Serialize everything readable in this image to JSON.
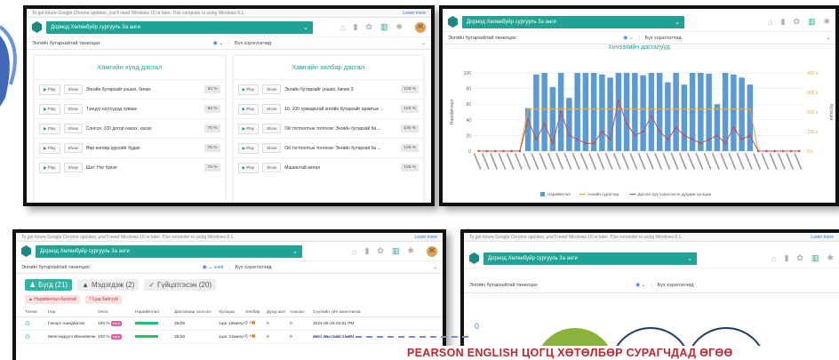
{
  "notice": {
    "text": "To get future Google Chrome updates, you'll need Windows 10 or later. This computer is using Windows 8.1.",
    "link": "Learn more"
  },
  "app": {
    "lesson_select": "Дорнод Хөлөнбуйр сургууль 3а анги",
    "avatar_letter": "Ж",
    "filter_left": "Энгийн бутархайтай танилцах",
    "filter_right": "Бүх хэрэглэгчид"
  },
  "panel1": {
    "left_title": "Хамгийн хүнд дасгал",
    "right_title": "Хамгийн хялбар дасгал",
    "play_label": "Play",
    "show_label": "Show",
    "hard": [
      {
        "title": "Энгийн бутархайг унших, бичих",
        "pct": "54 %"
      },
      {
        "title": "Тэнцүү хэсгүүдэд хуваах",
        "pct": "68 %"
      },
      {
        "title": "Сонсох: 100 дотор нэмэх, хасах",
        "pct": "70 %"
      },
      {
        "title": "Өөр өнгөөр дүрсийг будах",
        "pct": "76 %"
      },
      {
        "title": "Шат: Ног букэл",
        "pct": "78 %"
      }
    ],
    "easy": [
      {
        "title": "Энгийн бутархайг унших, бичих 3",
        "pct": "100 %"
      },
      {
        "title": "10, 100 хуваарьтай энгийн бутархайг аравтын ...",
        "pct": "100 %"
      },
      {
        "title": "Ой тогтоолтын тоглоом: Энгийн бутархай ба ...",
        "pct": "100 %"
      },
      {
        "title": "Ой тогтоолтын тоглоом: Энгийн бутархай ба ...",
        "pct": "100 %"
      },
      {
        "title": "Машинтай аялал",
        "pct": "100 %"
      }
    ]
  },
  "chart_data": {
    "type": "bar",
    "title": "Хичээлийн дасгалууд",
    "ylabel": "Нарийвчлал",
    "ylabel_right": "Хугацаа",
    "yticks": [
      "0",
      "20",
      "40",
      "60",
      "80",
      "100"
    ],
    "yticks_right": [
      "0 s",
      "100 s",
      "200 s",
      "300 s",
      "400 s"
    ],
    "ylim": [
      0,
      100
    ],
    "ylim_right": [
      0,
      400
    ],
    "categories": [
      "1",
      "2",
      "3",
      "4",
      "5",
      "6",
      "7",
      "8",
      "9",
      "10",
      "11",
      "12",
      "13",
      "14",
      "15",
      "16",
      "17",
      "18",
      "19",
      "20",
      "21",
      "22",
      "23",
      "24",
      "25",
      "26",
      "27",
      "28",
      "29",
      "30",
      "31",
      "32",
      "33",
      "34",
      "35",
      "36",
      "37",
      "38",
      "39",
      "40"
    ],
    "series": [
      {
        "name": "Нарийвчлал",
        "kind": "bar",
        "color": "#5b9bd5",
        "values": [
          0,
          0,
          0,
          0,
          0,
          0,
          55,
          98,
          100,
          82,
          100,
          68,
          100,
          100,
          100,
          98,
          94,
          100,
          100,
          100,
          97,
          100,
          100,
          88,
          100,
          85,
          100,
          100,
          99,
          60,
          100,
          98,
          94,
          85,
          0,
          0,
          0,
          0,
          0,
          0
        ]
      },
      {
        "name": "Ангийн сурагчид",
        "kind": "line",
        "color": "#e8a33c",
        "values": [
          0,
          0,
          0,
          0,
          0,
          0,
          215,
          215,
          215,
          215,
          215,
          215,
          215,
          215,
          215,
          215,
          215,
          215,
          215,
          215,
          215,
          215,
          215,
          215,
          215,
          215,
          215,
          215,
          215,
          215,
          215,
          215,
          215,
          215,
          0,
          0,
          0,
          0,
          0,
          0
        ]
      },
      {
        "name": "Дасгал руу хэрэглэсэн дундаж хугацаа",
        "kind": "line",
        "color": "#c0504d",
        "values": [
          0,
          0,
          0,
          0,
          0,
          0,
          160,
          60,
          140,
          40,
          200,
          80,
          60,
          40,
          40,
          100,
          60,
          260,
          140,
          80,
          100,
          180,
          100,
          60,
          120,
          80,
          60,
          40,
          60,
          80,
          40,
          120,
          60,
          80,
          0,
          0,
          0,
          0,
          0,
          0
        ]
      }
    ],
    "legend_position": "bottom"
  },
  "panel3": {
    "tabs": [
      {
        "label": "Бүгд (21)"
      },
      {
        "label": "Мэдэгдэж (2)"
      },
      {
        "label": "Гүйцэтгэсэн (20)"
      }
    ],
    "actions": [
      "Нарийвчлал багатай",
      "Цаа байгууй"
    ],
    "columns": [
      "Төлөв",
      "Нэр",
      "Оноо",
      "Нарийвчлал",
      "Дасгалаар эзэгсэн",
      "Хугацаа",
      "Хялбар",
      "Дунд шат",
      "Ахисан",
      "Сүүлийн үйл ажиллагаа"
    ],
    "rows": [
      {
        "name": "Ганзул Ашидбатан",
        "score": "100 %",
        "tag": "тэгш",
        "ex": "25/25",
        "time": "1цаг 18минут",
        "easy": "5 +",
        "mid": "0",
        "adv": "0",
        "last": "2024-05-15 04:51 PM"
      },
      {
        "name": "Менгэндүүгэ Мөнхөөгөн",
        "score": "100 %",
        "tag": "тэгш",
        "ex": "25/25",
        "time": "1цаг 31минут",
        "easy": "5 +",
        "mid": "0",
        "adv": "0",
        "last": "2024-05-15 04:51 PM"
      }
    ],
    "extra": "эний"
  },
  "panel4": {
    "num": "0"
  },
  "banner": "PEARSON ENGLISH ЦОГЦ ХӨТӨЛБӨР СУРАГЧДАД ӨГӨӨ"
}
